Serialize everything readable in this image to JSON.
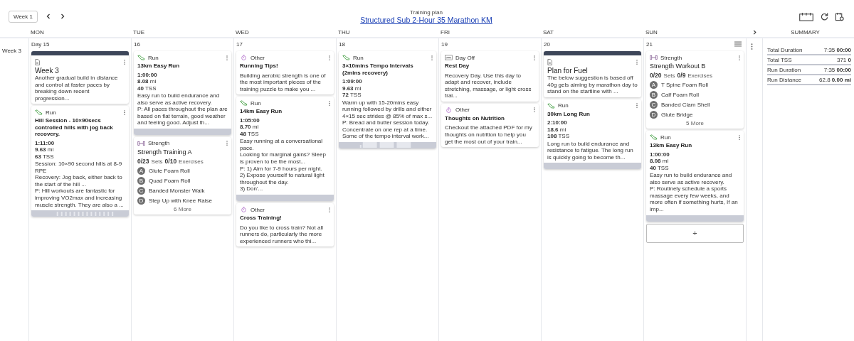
{
  "header": {
    "week_button": "Week 1",
    "subtitle": "Training plan",
    "title": "Structured Sub 2-Hour 35 Marathon KM"
  },
  "days": [
    "MON",
    "TUE",
    "WED",
    "THU",
    "FRI",
    "SAT",
    "SUN"
  ],
  "summary_heading": "SUMMARY",
  "week_label": "Week 3",
  "columns": [
    {
      "date": "Day 15",
      "items": [
        {
          "kind": "note",
          "title": "Week 3",
          "text": "Another gradual build in distance and control at faster paces by breaking down recent progression..."
        },
        {
          "kind": "run",
          "type_label": "Run",
          "title": "Hill Session - 10×90secs controlled hills with jog back recovery.",
          "duration": "1:11:00",
          "distance": "9.63",
          "distance_unit": "mi",
          "tss": "63",
          "tss_unit": "TSS",
          "description": [
            "Session: 10×90 second hills at 8-9 RPE",
            "Recovery: Jog back, either back to the start of the hill ...",
            "P: Hill workouts are fantastic for improving VO2max and increasing muscle strength. They are also a ..."
          ],
          "graph": {
            "kind": "intervals"
          }
        }
      ]
    },
    {
      "date": "16",
      "items": [
        {
          "kind": "run",
          "type_label": "Run",
          "title": "13km Easy Run",
          "duration": "1:00:00",
          "distance": "8.08",
          "distance_unit": "mi",
          "tss": "40",
          "tss_unit": "TSS",
          "description": [
            "Easy run to build endurance and also serve as active recovery.",
            "P: All paces throughout the plan are based on flat terrain, good weather and feeling good. Adjust th..."
          ],
          "graph": {
            "kind": "steady"
          }
        },
        {
          "kind": "strength",
          "type_label": "Strength",
          "title": "Strength Training A",
          "sets": "0/23",
          "sets_label": "Sets",
          "exercises": "0/10",
          "exercises_label": "Exercises",
          "list": [
            {
              "letter": "A",
              "name": "Glute Foam Roll"
            },
            {
              "letter": "B",
              "name": "Quad Foam Roll"
            },
            {
              "letter": "C",
              "name": "Banded Monster Walk"
            },
            {
              "letter": "D",
              "name": "Step Up with Knee Raise"
            }
          ],
          "more": "6 More"
        }
      ]
    },
    {
      "date": "17",
      "items": [
        {
          "kind": "other",
          "type_label": "Other",
          "title": "Running Tips!",
          "description": [
            "Building aerobic strength is one of the most important pieces of the training puzzle to make you ..."
          ]
        },
        {
          "kind": "run",
          "type_label": "Run",
          "title": "14km Easy Run",
          "duration": "1:05:00",
          "distance": "8.70",
          "distance_unit": "mi",
          "tss": "48",
          "tss_unit": "TSS",
          "description": [
            "Easy running at a conversational pace.",
            "Looking for marginal gains? Sleep is proven to be the most...",
            "P: 1) Aim for 7-9 hours per night.",
            "2) Expose yourself to natural light throughout the day.",
            "3) Don'..."
          ],
          "graph": {
            "kind": "steady"
          }
        },
        {
          "kind": "other",
          "type_label": "Other",
          "title": "Cross Training!",
          "description": [
            "Do you like to cross train? Not all runners do, particularly the more experienced runners who thi..."
          ]
        }
      ]
    },
    {
      "date": "18",
      "items": [
        {
          "kind": "run",
          "type_label": "Run",
          "title": "3×10mins Tempo Intervals (2mins recovery)",
          "duration": "1:09:00",
          "distance": "9.63",
          "distance_unit": "mi",
          "tss": "72",
          "tss_unit": "TSS",
          "description": [
            "Warm up with 15-20mins easy running followed by drills and either 4×15 sec strides @ 85% of max s...",
            "P: Bread and butter session today. Concentrate on one rep at a time. Some of the tempo interval work..."
          ],
          "graph": {
            "kind": "tempo"
          }
        }
      ]
    },
    {
      "date": "19",
      "items": [
        {
          "kind": "dayoff",
          "type_label": "Day Off",
          "title": "Rest Day",
          "description": [
            "Recovery Day. Use this day to adapt and recover, include stretching, massage, or light cross trai..."
          ]
        },
        {
          "kind": "other",
          "type_label": "Other",
          "title": "Thoughts on Nutrition",
          "description": [
            "Checkout the attached PDF for my thoughts on nutrition to help you get the most out of your train..."
          ]
        }
      ]
    },
    {
      "date": "20",
      "items": [
        {
          "kind": "note",
          "title": "Plan for Fuel",
          "text": "The below suggestion is based off 40g gels aiming by marathon day to stand on the startline with ..."
        },
        {
          "kind": "run",
          "type_label": "Run",
          "title": "30km Long Run",
          "duration": "2:10:00",
          "distance": "18.6",
          "distance_unit": "mi",
          "tss": "108",
          "tss_unit": "TSS",
          "description": [
            "Long run to build endurance and resistance to fatigue. The long run is quickly going to become th..."
          ],
          "graph": {
            "kind": "steady"
          }
        }
      ]
    },
    {
      "date": "21",
      "items": [
        {
          "kind": "strength",
          "type_label": "Strength",
          "title": "Strength Workout B",
          "sets": "0/20",
          "sets_label": "Sets",
          "exercises": "0/9",
          "exercises_label": "Exercises",
          "list": [
            {
              "letter": "A",
              "name": "T Spine Foam Roll"
            },
            {
              "letter": "B",
              "name": "Calf Foam Roll"
            },
            {
              "letter": "C",
              "name": "Banded Clam Shell"
            },
            {
              "letter": "D",
              "name": "Glute Bridge"
            }
          ],
          "more": "5 More"
        },
        {
          "kind": "run",
          "type_label": "Run",
          "title": "13km Easy Run",
          "duration": "1:00:00",
          "distance": "8.08",
          "distance_unit": "mi",
          "tss": "40",
          "tss_unit": "TSS",
          "description": [
            "Easy run to build endurance and also serve as active recovery.",
            "P: Routinely schedule a sports massage every few weeks, and more often if something hurts, If an imp..."
          ],
          "graph": {
            "kind": "steady"
          }
        }
      ],
      "add_button": "+"
    }
  ],
  "summary": [
    {
      "label": "Total Duration",
      "value": "7:35",
      "value_bold": "00:00"
    },
    {
      "label": "Total TSS",
      "value": "371",
      "value_bold": "0"
    },
    {
      "label": "Run Duration",
      "value": "7:35",
      "value_bold": "00:00"
    },
    {
      "label": "Run Distance",
      "value": "62.8",
      "value_bold": "0.00 mi"
    }
  ]
}
